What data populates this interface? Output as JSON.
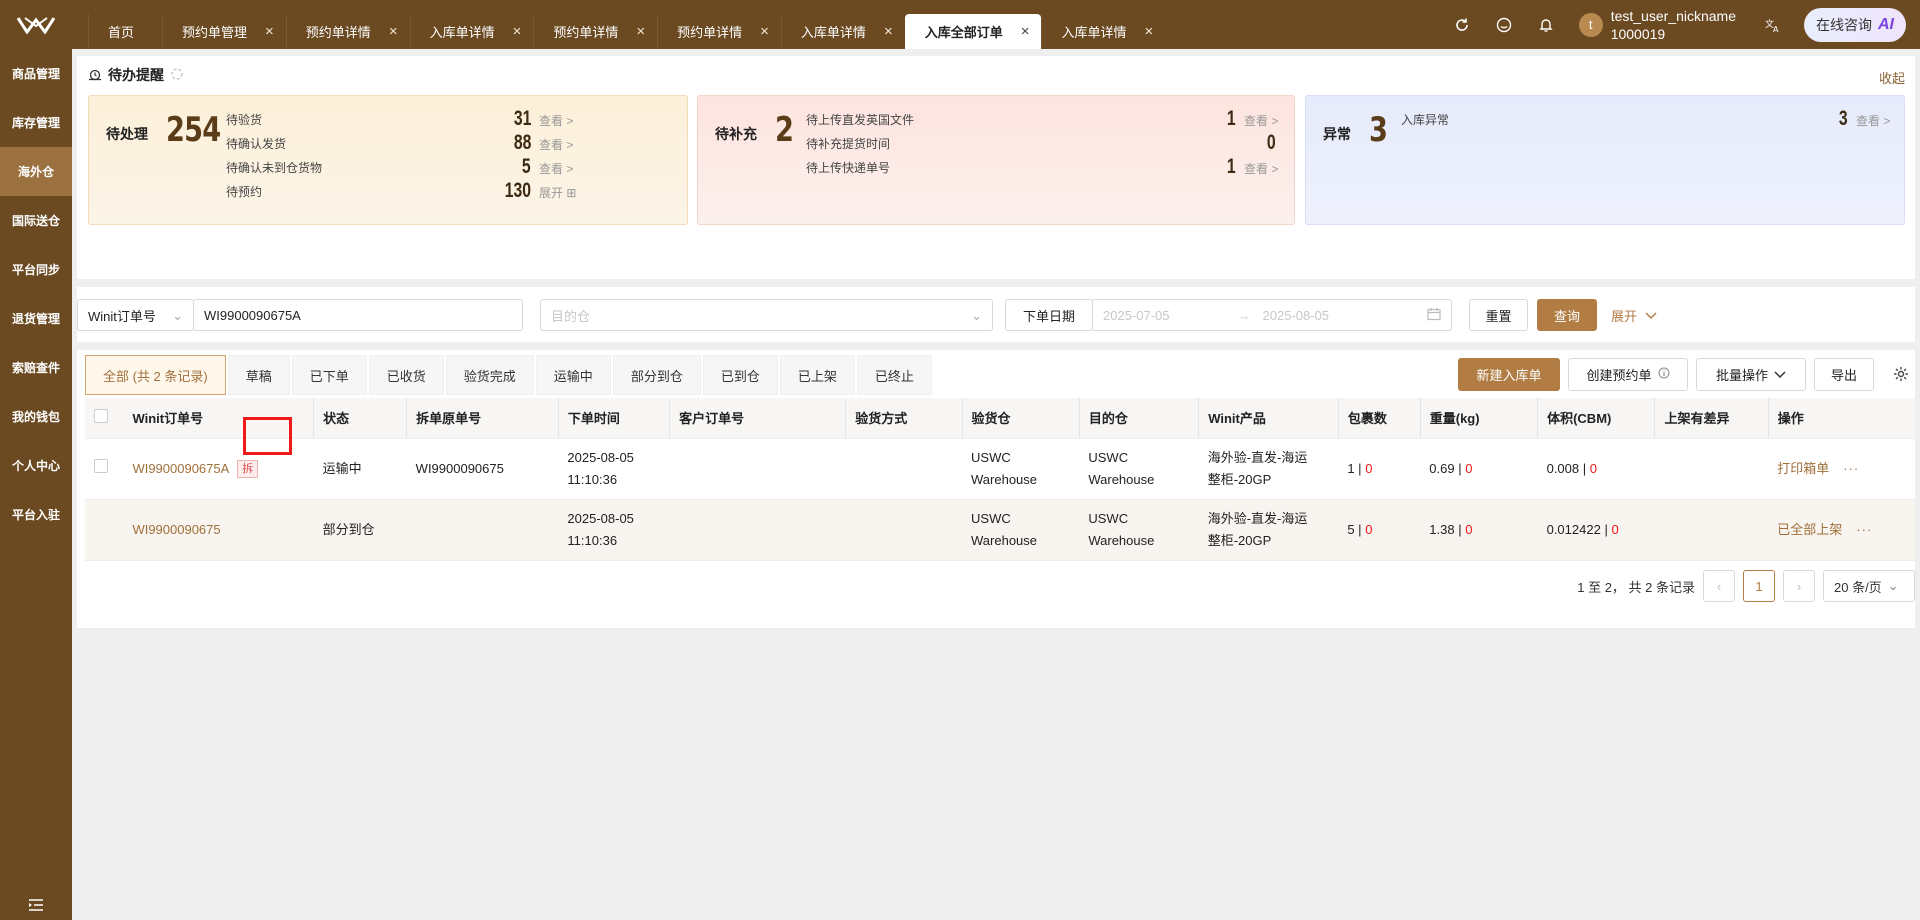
{
  "header": {
    "tabs": [
      {
        "label": "首页",
        "closable": false
      },
      {
        "label": "预约单管理",
        "closable": true
      },
      {
        "label": "预约单详情",
        "closable": true
      },
      {
        "label": "入库单详情",
        "closable": true
      },
      {
        "label": "预约单详情",
        "closable": true
      },
      {
        "label": "预约单详情",
        "closable": true
      },
      {
        "label": "入库单详情",
        "closable": true
      },
      {
        "label": "入库全部订单",
        "closable": true,
        "active": true
      },
      {
        "label": "入库单详情",
        "closable": true
      }
    ],
    "user": {
      "avatar_letter": "t",
      "nickname": "test_user_nickname",
      "id": "1000019"
    },
    "consult_label": "在线咨询",
    "ai_label": "AI"
  },
  "sidebar": {
    "items": [
      {
        "label": "商品管理"
      },
      {
        "label": "库存管理"
      },
      {
        "label": "海外仓",
        "active": true
      },
      {
        "label": "国际送仓"
      },
      {
        "label": "平台同步"
      },
      {
        "label": "退货管理"
      },
      {
        "label": "索赔查件"
      },
      {
        "label": "我的钱包"
      },
      {
        "label": "个人中心"
      },
      {
        "label": "平台入驻"
      }
    ]
  },
  "todo": {
    "title": "待办提醒",
    "collapse_label": "收起",
    "view_label": "查看 >",
    "expand_label": "展开",
    "cards": {
      "pending": {
        "title": "待处理",
        "total": "254",
        "rows": [
          {
            "label": "待验货",
            "value": "31"
          },
          {
            "label": "待确认发货",
            "value": "88"
          },
          {
            "label": "待确认未到仓货物",
            "value": "5"
          },
          {
            "label": "待预约",
            "value": "130"
          }
        ]
      },
      "supplement": {
        "title": "待补充",
        "total": "2",
        "rows": [
          {
            "label": "待上传直发英国文件",
            "value": "1"
          },
          {
            "label": "待补充提货时间",
            "value": "0"
          },
          {
            "label": "待上传快递单号",
            "value": "1"
          }
        ]
      },
      "exception": {
        "title": "异常",
        "total": "3",
        "rows": [
          {
            "label": "入库异常",
            "value": "3"
          }
        ]
      }
    }
  },
  "filter": {
    "field_select": "Winit订单号",
    "field_value": "WI9900090675A",
    "warehouse_placeholder": "目的仓",
    "date_label": "下单日期",
    "date_start": "2025-07-05",
    "date_end": "2025-08-05",
    "reset_label": "重置",
    "query_label": "查询",
    "expand_label": "展开"
  },
  "status_tabs": [
    {
      "label": "全部 (共 2 条记录)",
      "active": true
    },
    {
      "label": "草稿"
    },
    {
      "label": "已下单"
    },
    {
      "label": "已收货"
    },
    {
      "label": "验货完成"
    },
    {
      "label": "运输中"
    },
    {
      "label": "部分到仓"
    },
    {
      "label": "已到仓"
    },
    {
      "label": "已上架"
    },
    {
      "label": "已终止"
    }
  ],
  "actions": {
    "new_label": "新建入库单",
    "create_booking_label": "创建预约单",
    "batch_label": "批量操作",
    "export_label": "导出"
  },
  "table": {
    "columns": [
      "Winit订单号",
      "状态",
      "拆单原单号",
      "下单时间",
      "客户订单号",
      "验货方式",
      "验货仓",
      "目的仓",
      "Winit产品",
      "包裹数",
      "重量(kg)",
      "体积(CBM)",
      "上架有差异",
      "操作"
    ],
    "split_tag": "拆",
    "rows": [
      {
        "order_no": "WI9900090675A",
        "status": "运输中",
        "origin_no": "WI9900090675",
        "date": "2025-08-05",
        "time": "11:10:36",
        "customer_no": "",
        "inspect_method": "",
        "inspect_wh_1": "USWC",
        "inspect_wh_2": "Warehouse",
        "dest_wh_1": "USWC",
        "dest_wh_2": "Warehouse",
        "product_1": "海外验-直发-海运",
        "product_2": "整柜-20GP",
        "packages": "1",
        "packages_diff": "0",
        "weight": "0.69",
        "weight_diff": "0",
        "volume": "0.008",
        "volume_diff": "0",
        "diff": "",
        "op": "打印箱单"
      },
      {
        "order_no": "WI9900090675",
        "status": "部分到仓",
        "origin_no": "",
        "date": "2025-08-05",
        "time": "11:10:36",
        "customer_no": "",
        "inspect_method": "",
        "inspect_wh_1": "USWC",
        "inspect_wh_2": "Warehouse",
        "dest_wh_1": "USWC",
        "dest_wh_2": "Warehouse",
        "product_1": "海外验-直发-海运",
        "product_2": "整柜-20GP",
        "packages": "5",
        "packages_diff": "0",
        "weight": "1.38",
        "weight_diff": "0",
        "volume": "0.012422",
        "volume_diff": "0",
        "diff": "",
        "op": "已全部上架"
      }
    ],
    "separator": "|",
    "more": "···"
  },
  "pagination": {
    "summary": "1 至 2， 共 2 条记录",
    "current_page": "1",
    "page_size": "20 条/页"
  },
  "colors": {
    "brand": "#6b4a22",
    "accent": "#b17d44",
    "error": "#f01818"
  }
}
